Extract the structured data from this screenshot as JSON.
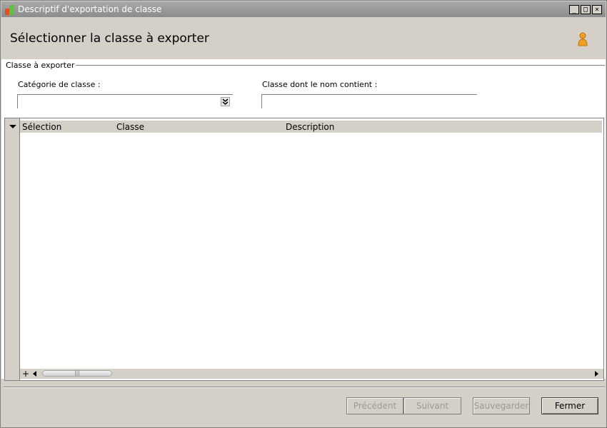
{
  "window": {
    "title": "Descriptif d'exportation de classe",
    "controls": {
      "minimize": "_",
      "maximize": "□",
      "close": "×"
    }
  },
  "header": {
    "title": "Sélectionner la classe à exporter",
    "icon": "user-icon"
  },
  "group": {
    "label": "Classe à exporter",
    "category_label": "Catégorie de classe :",
    "category_value": "",
    "name_filter_label": "Classe dont le nom contient :",
    "name_filter_value": ""
  },
  "grid": {
    "columns": [
      "Sélection",
      "Classe",
      "Description"
    ],
    "rows": [],
    "add_label": "+",
    "scroll_thumb_grip": "|||"
  },
  "buttons": {
    "previous": "Précédent",
    "next": "Suivant",
    "save": "Sauvegarder",
    "close": "Fermer"
  },
  "colors": {
    "window_bg": "#d4d0c8",
    "title_bar": "#8c8c8c",
    "content_bg": "#ffffff",
    "icon_accent": "#f0a020"
  }
}
